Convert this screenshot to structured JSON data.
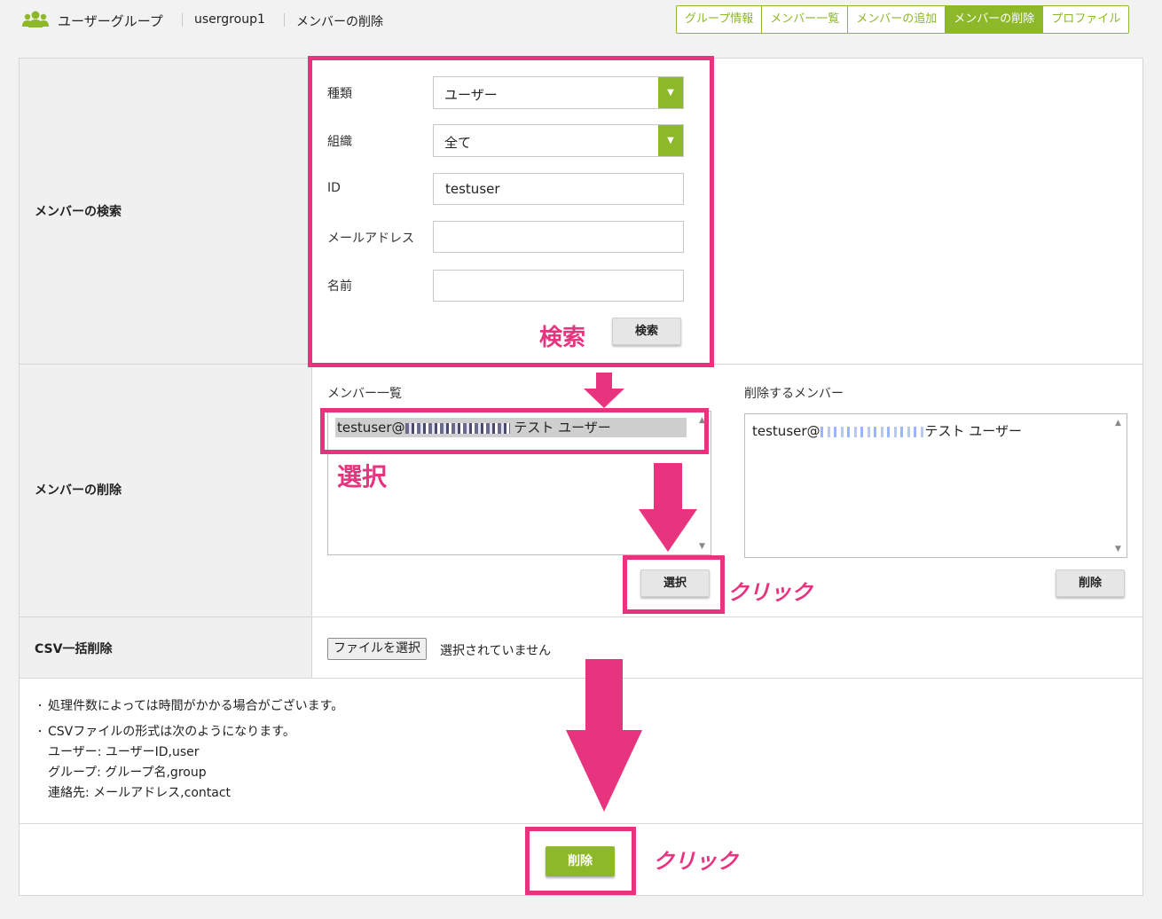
{
  "header": {
    "title": "ユーザーグループ",
    "group_name": "usergroup1",
    "page_name": "メンバーの削除",
    "icon": "users-icon"
  },
  "tabs": [
    {
      "label": "グループ情報",
      "active": false
    },
    {
      "label": "メンバー一覧",
      "active": false
    },
    {
      "label": "メンバーの追加",
      "active": false
    },
    {
      "label": "メンバーの削除",
      "active": true
    },
    {
      "label": "プロファイル",
      "active": false
    }
  ],
  "search": {
    "section_label": "メンバーの検索",
    "type_label": "種類",
    "type_value": "ユーザー",
    "org_label": "組織",
    "org_value": "全て",
    "id_label": "ID",
    "id_value": "testuser",
    "email_label": "メールアドレス",
    "email_value": "",
    "name_label": "名前",
    "name_value": "",
    "search_button": "検索"
  },
  "delete": {
    "section_label": "メンバーの削除",
    "list_label": "メンバー一覧",
    "list_item_prefix": "testuser@",
    "list_item_suffix": "テスト ユーザー",
    "select_button": "選択",
    "target_label": "削除するメンバー",
    "target_item_prefix": "testuser@",
    "target_item_suffix": "テスト ユーザー",
    "remove_button": "削除"
  },
  "csv": {
    "section_label": "CSV一括削除",
    "file_button": "ファイルを選択",
    "file_status": "選択されていません"
  },
  "notes": {
    "bullet": "・",
    "line1": "処理件数によっては時間がかかる場合がございます。",
    "line2": "CSVファイルの形式は次のようになります。",
    "line3": "ユーザー: ユーザーID,user",
    "line4": "グループ: グループ名,group",
    "line5": "連絡先: メールアドレス,contact"
  },
  "footer": {
    "delete_button": "削除"
  },
  "annotations": {
    "search_note": "検索",
    "select_note": "選択",
    "click_note1": "クリック",
    "click_note2": "クリック",
    "color": "#e8347f"
  },
  "colors": {
    "accent": "#8cb82a",
    "annotation": "#e8347f"
  }
}
